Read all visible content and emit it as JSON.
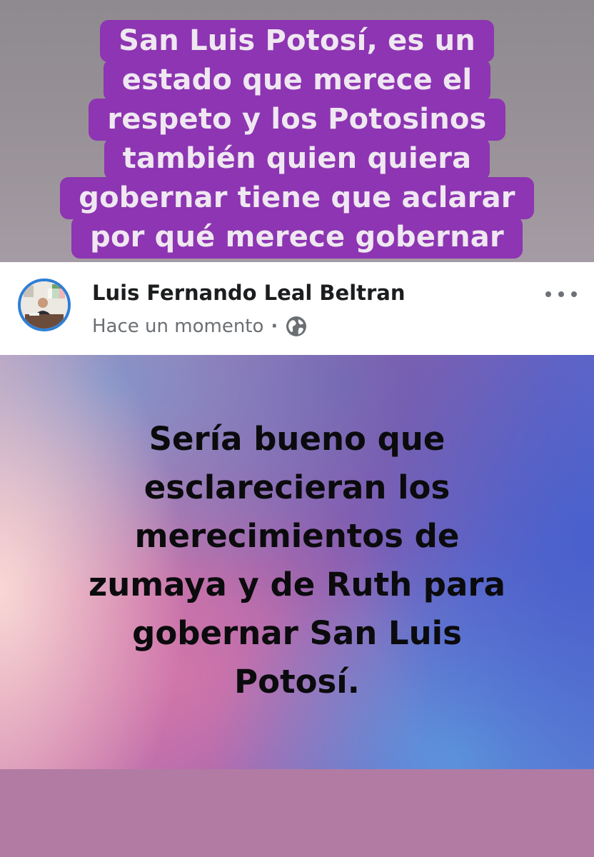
{
  "story_caption": {
    "lines": [
      "San Luis Potosí, es un",
      "estado que merece el",
      "respeto y los Potosinos",
      "también quien quiera",
      "gobernar tiene que aclarar",
      "por qué merece gobernar"
    ],
    "background_color": "#8d35b2"
  },
  "post": {
    "author_name": "Luis Fernando Leal Beltran",
    "timestamp": "Hace un momento",
    "separator": "·",
    "privacy_icon": "globe-icon",
    "menu_icon": "more-icon",
    "avatar_ring_color": "#2e7fd6",
    "text": "Sería bueno que\nesclarecieran los\nmerecimientos de\nzumaya y de Ruth para\ngobernar San Luis\nPotosí."
  }
}
